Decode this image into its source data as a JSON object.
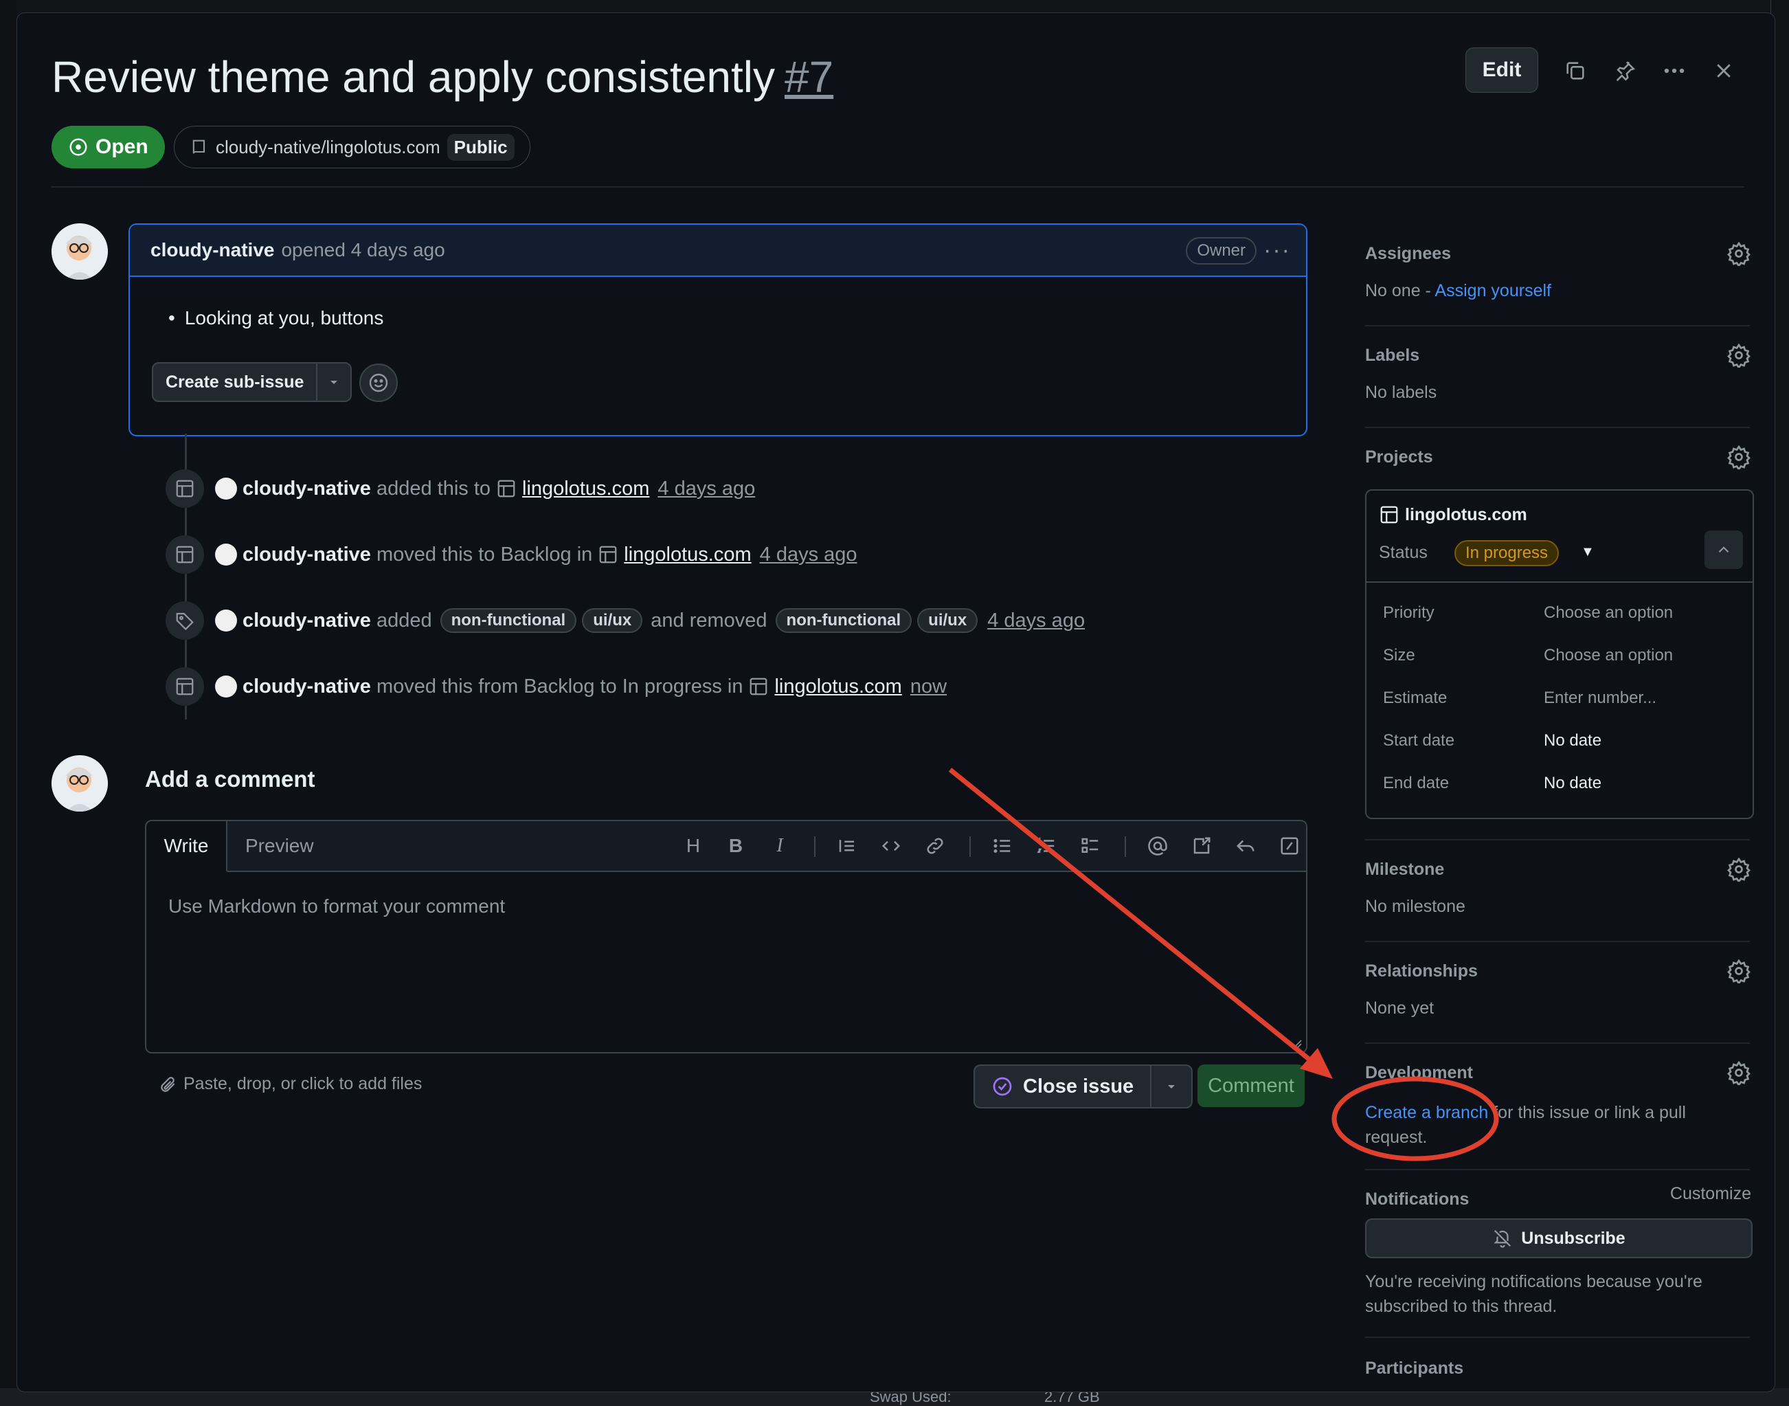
{
  "issue": {
    "title": "Review theme and apply consistently",
    "number": "#7",
    "state": "Open",
    "repo": "cloudy-native/lingolotus.com",
    "visibility": "Public"
  },
  "header_actions": {
    "edit_label": "Edit",
    "icons": [
      "copy-icon",
      "pin-icon",
      "kebab-icon",
      "close-icon"
    ]
  },
  "comment": {
    "author": "cloudy-native",
    "meta": "opened 4 days ago",
    "role": "Owner",
    "body_items": [
      "Looking at you, buttons"
    ],
    "sub_issue_label": "Create sub-issue"
  },
  "timeline": [
    {
      "actor": "cloudy-native",
      "text": "added this to",
      "project": "lingolotus.com",
      "time": "4 days ago"
    },
    {
      "actor": "cloudy-native",
      "text": "moved this to Backlog in",
      "project": "lingolotus.com",
      "time": "4 days ago"
    },
    {
      "actor": "cloudy-native",
      "text_added": "added",
      "added_labels": [
        "non-functional",
        "ui/ux"
      ],
      "text_removed": "and removed",
      "removed_labels": [
        "non-functional",
        "ui/ux"
      ],
      "time": "4 days ago"
    },
    {
      "actor": "cloudy-native",
      "text": "moved this from Backlog to In progress in",
      "project": "lingolotus.com",
      "time": "now"
    }
  ],
  "add_comment": {
    "title": "Add a comment",
    "tab_write": "Write",
    "tab_preview": "Preview",
    "placeholder": "Use Markdown to format your comment",
    "attach_text": "Paste, drop, or click to add files",
    "close_issue_label": "Close issue",
    "comment_label": "Comment",
    "toolbar": [
      "H",
      "B",
      "I"
    ]
  },
  "sidebar": {
    "assignees": {
      "title": "Assignees",
      "none": "No one - ",
      "assign_link": "Assign yourself"
    },
    "labels": {
      "title": "Labels",
      "value": "No labels"
    },
    "projects": {
      "title": "Projects",
      "name": "lingolotus.com",
      "status_label": "Status",
      "status_value": "In progress",
      "fields": [
        {
          "name": "Priority",
          "value": "Choose an option"
        },
        {
          "name": "Size",
          "value": "Choose an option"
        },
        {
          "name": "Estimate",
          "value": "Enter number..."
        },
        {
          "name": "Start date",
          "value": "No date"
        },
        {
          "name": "End date",
          "value": "No date"
        }
      ]
    },
    "milestone": {
      "title": "Milestone",
      "value": "No milestone"
    },
    "relationships": {
      "title": "Relationships",
      "value": "None yet"
    },
    "development": {
      "title": "Development",
      "link": "Create a branch",
      "rest1": " for this issue or link a pull",
      "rest2": "request."
    },
    "notifications": {
      "title": "Notifications",
      "customize": "Customize",
      "button": "Unsubscribe",
      "note1": "You're receiving notifications because you're",
      "note2": "subscribed to this thread."
    },
    "participants": {
      "title": "Participants"
    }
  },
  "background": {
    "swap_label": "Swap Used:",
    "swap_value": "2.77 GB"
  },
  "colors": {
    "accent": "#1f6feb",
    "open": "#238636",
    "link": "#4493f8",
    "annotation": "#e0402e"
  }
}
